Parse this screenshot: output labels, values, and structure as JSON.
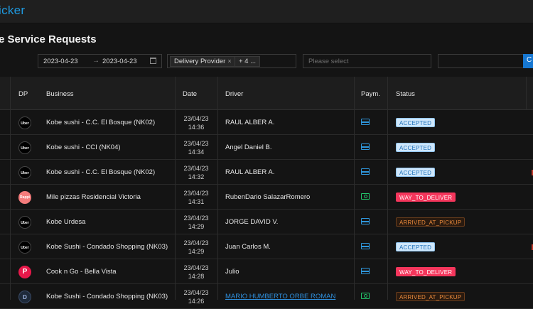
{
  "app": {
    "brand": "icker"
  },
  "page": {
    "title": "e Service Requests"
  },
  "filters": {
    "date_from": "2023-04-23",
    "date_to": "2023-04-23",
    "provider_tag": "Delivery Provider",
    "provider_tag_close": "×",
    "more_tag": "+ 4 ...",
    "select_placeholder": "Please select",
    "search_button": "C"
  },
  "table": {
    "headers": {
      "dp": "DP",
      "business": "Business",
      "date": "Date",
      "driver": "Driver",
      "payment": "Paym.",
      "status": "Status"
    },
    "rows": [
      {
        "logo": "uber",
        "logo_text": "Uber",
        "business": "Kobe sushi - C.C. El Bosque (NK02)",
        "date": "23/04/23",
        "time": "14:36",
        "driver": "RAUL ALBER A.",
        "payment": "card",
        "status": "ACCEPTED",
        "edge_mark": false
      },
      {
        "logo": "uber",
        "logo_text": "Uber",
        "business": "Kobe sushi - CCI (NK04)",
        "date": "23/04/23",
        "time": "14:34",
        "driver": "Angel Daniel B.",
        "payment": "card",
        "status": "ACCEPTED",
        "edge_mark": false
      },
      {
        "logo": "uber",
        "logo_text": "Uber",
        "business": "Kobe sushi - C.C. El Bosque (NK02)",
        "date": "23/04/23",
        "time": "14:32",
        "driver": "RAUL ALBER A.",
        "payment": "card",
        "status": "ACCEPTED",
        "edge_mark": true
      },
      {
        "logo": "pizza",
        "logo_text": "Rappi",
        "business": "Mile pizzas Residencial Victoria",
        "date": "23/04/23",
        "time": "14:31",
        "driver": "RubenDario SalazarRomero",
        "payment": "cash",
        "status": "WAY_TO_DELIVER",
        "edge_mark": false
      },
      {
        "logo": "uber",
        "logo_text": "Uber",
        "business": "Kobe Urdesa",
        "date": "23/04/23",
        "time": "14:29",
        "driver": "JORGE DAVID V.",
        "payment": "card",
        "status": "ARRIVED_AT_PICKUP",
        "edge_mark": false
      },
      {
        "logo": "uber",
        "logo_text": "Uber",
        "business": "Kobe Sushi - Condado Shopping (NK03)",
        "date": "23/04/23",
        "time": "14:29",
        "driver": "Juan Carlos M.",
        "payment": "card",
        "status": "ACCEPTED",
        "edge_mark": true
      },
      {
        "logo": "redp",
        "logo_text": "P",
        "business": "Cook n Go - Bella Vista",
        "date": "23/04/23",
        "time": "14:28",
        "driver": "Julio",
        "payment": "card",
        "status": "WAY_TO_DELIVER",
        "edge_mark": false
      },
      {
        "logo": "other",
        "logo_text": "D",
        "business": "Kobe Sushi - Condado Shopping (NK03)",
        "date": "23/04/23",
        "time": "14:26",
        "driver": "MARIO HUMBERTO ORBE ROMAN",
        "driver_link": true,
        "payment": "cash",
        "status": "ARRIVED_AT_PICKUP",
        "edge_mark": false
      }
    ]
  },
  "colors": {
    "accent": "#1f9ae0",
    "accepted": "#cfe7fb",
    "deliver": "#f5365c",
    "pickup": "#e88a3c"
  }
}
